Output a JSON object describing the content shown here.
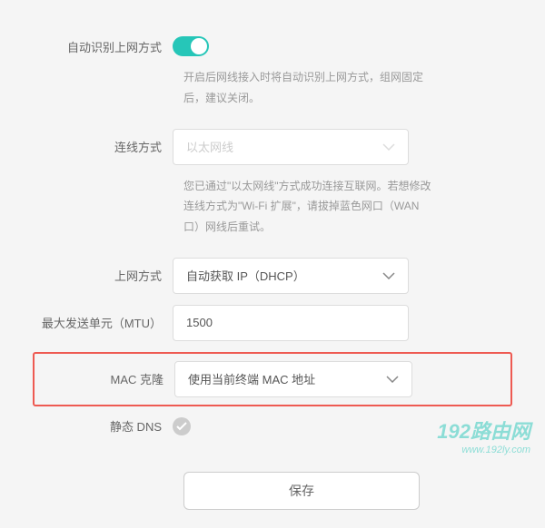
{
  "auto_detect": {
    "label": "自动识别上网方式",
    "enabled": true,
    "help": "开启后网线接入时将自动识别上网方式，组网固定后，建议关闭。"
  },
  "connection_type": {
    "label": "连线方式",
    "value": "以太网线",
    "disabled": true,
    "help": "您已通过\"以太网线\"方式成功连接互联网。若想修改连线方式为\"Wi-Fi 扩展\"，请拔掉蓝色网口（WAN 口）网线后重试。"
  },
  "internet_mode": {
    "label": "上网方式",
    "value": "自动获取 IP（DHCP）"
  },
  "mtu": {
    "label": "最大发送单元（MTU）",
    "value": "1500"
  },
  "mac_clone": {
    "label": "MAC 克隆",
    "value": "使用当前终端 MAC 地址",
    "highlighted": true
  },
  "static_dns": {
    "label": "静态 DNS",
    "enabled": false
  },
  "save_button": "保存",
  "watermark": {
    "line1": "192路由网",
    "line2": "www.192ly.com"
  }
}
